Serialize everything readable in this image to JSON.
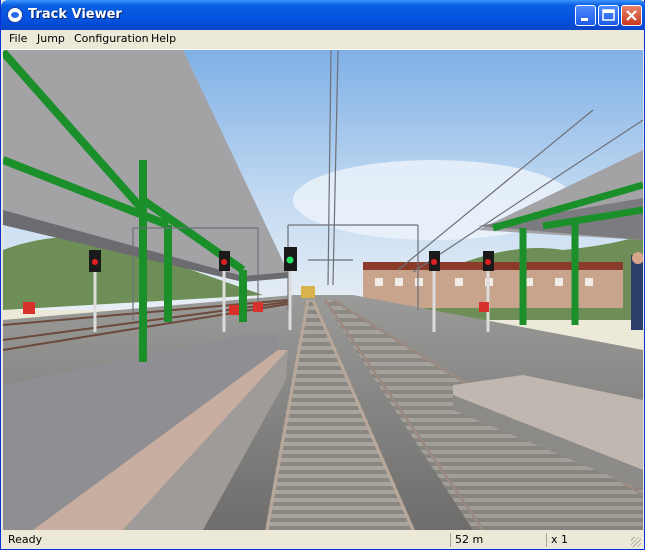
{
  "window": {
    "title": "Track Viewer"
  },
  "menu": {
    "items": [
      "File",
      "Jump",
      "Configuration",
      "Help"
    ]
  },
  "status": {
    "message": "Ready",
    "distance": "52 m",
    "speed": "x 1"
  },
  "colors": {
    "titlebar": "#0553e0",
    "canopy_frame": "#1a8f2a",
    "sky": "#9fc3e8",
    "ballast": "#7c7f86",
    "platform": "#c7aea0"
  },
  "icons": [
    "app-icon",
    "minimize-icon",
    "maximize-icon",
    "close-icon",
    "resize-grip-icon"
  ]
}
